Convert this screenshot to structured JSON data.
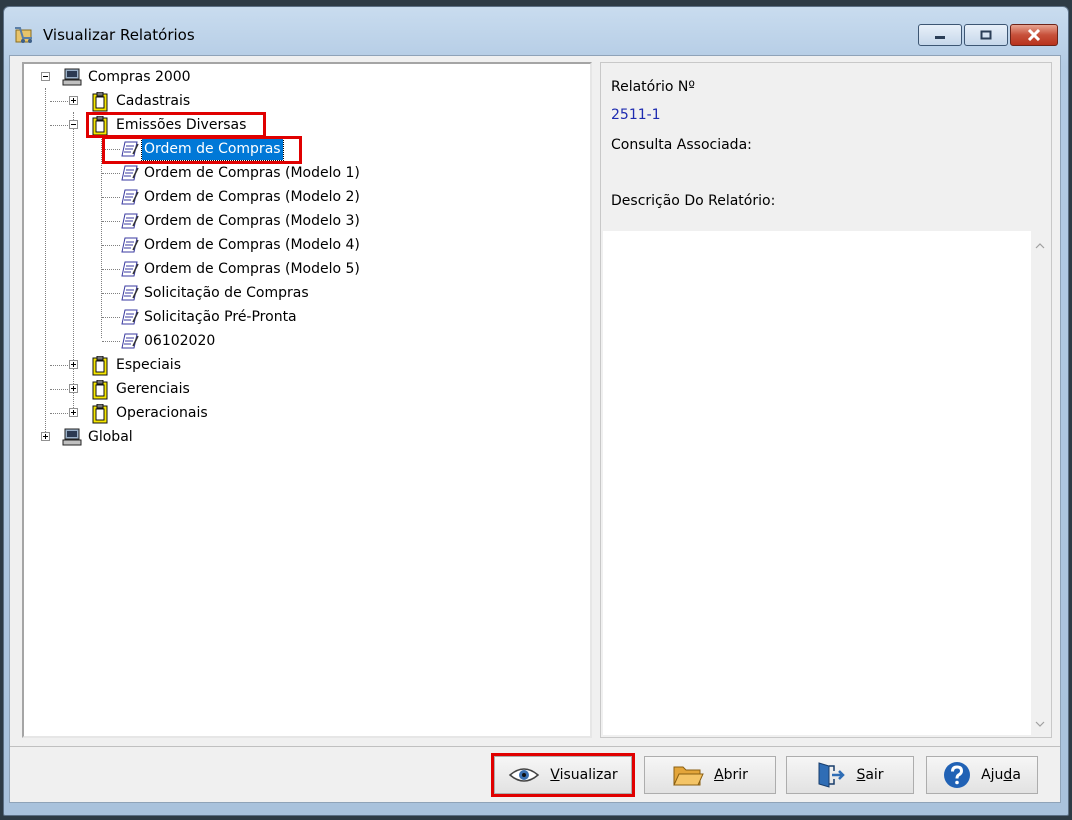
{
  "window": {
    "title": "Visualizar Relatórios"
  },
  "tree": {
    "root1": "Compras 2000",
    "cadastrais": "Cadastrais",
    "emissoes": "Emissões Diversas",
    "items": [
      "Ordem de Compras",
      "Ordem de Compras (Modelo 1)",
      "Ordem de Compras (Modelo 2)",
      "Ordem de Compras (Modelo 3)",
      "Ordem de Compras (Modelo 4)",
      "Ordem de Compras (Modelo 5)",
      "Solicitação de Compras",
      "Solicitação Pré-Pronta",
      "06102020"
    ],
    "especiais": "Especiais",
    "gerenciais": "Gerenciais",
    "operacionais": "Operacionais",
    "root2": "Global"
  },
  "info": {
    "relatorio_label": "Relatório Nº",
    "relatorio_value": "2511-1",
    "consulta_label": "Consulta Associada:",
    "descricao_label": "Descrição Do Relatório:"
  },
  "buttons": {
    "visualizar": {
      "pre": "",
      "ul": "V",
      "post": "isualizar"
    },
    "abrir": {
      "pre": "",
      "ul": "A",
      "post": "brir"
    },
    "sair": {
      "pre": "",
      "ul": "S",
      "post": "air"
    },
    "ajuda": {
      "pre": "Aju",
      "ul": "d",
      "post": "a"
    }
  },
  "colors": {
    "selection": "#0078d7",
    "highlight_box": "#e00000",
    "value_text": "#1e2bb0"
  }
}
